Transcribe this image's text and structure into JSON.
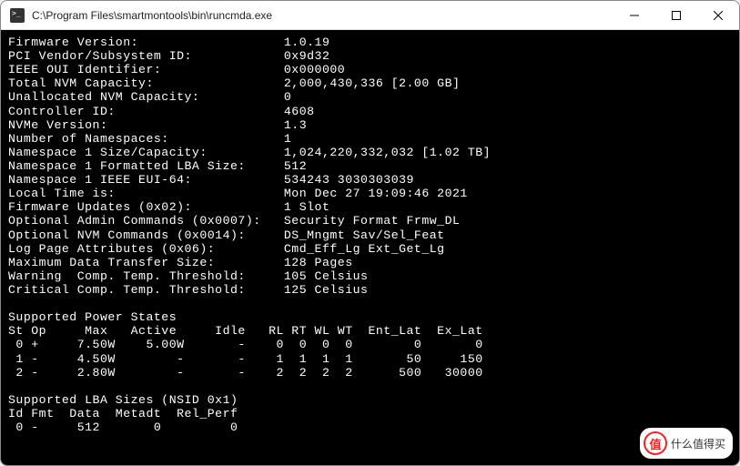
{
  "window": {
    "title": "C:\\Program Files\\smartmontools\\bin\\runcmda.exe"
  },
  "info_rows": [
    {
      "label": "Firmware Version:",
      "value": "1.0.19"
    },
    {
      "label": "PCI Vendor/Subsystem ID:",
      "value": "0x9d32"
    },
    {
      "label": "IEEE OUI Identifier:",
      "value": "0x000000"
    },
    {
      "label": "Total NVM Capacity:",
      "value": "2,000,430,336 [2.00 GB]"
    },
    {
      "label": "Unallocated NVM Capacity:",
      "value": "0"
    },
    {
      "label": "Controller ID:",
      "value": "4608"
    },
    {
      "label": "NVMe Version:",
      "value": "1.3"
    },
    {
      "label": "Number of Namespaces:",
      "value": "1"
    },
    {
      "label": "Namespace 1 Size/Capacity:",
      "value": "1,024,220,332,032 [1.02 TB]"
    },
    {
      "label": "Namespace 1 Formatted LBA Size:",
      "value": "512"
    },
    {
      "label": "Namespace 1 IEEE EUI-64:",
      "value": "534243 3030303039"
    },
    {
      "label": "Local Time is:",
      "value": "Mon Dec 27 19:09:46 2021"
    },
    {
      "label": "Firmware Updates (0x02):",
      "value": "1 Slot"
    },
    {
      "label": "Optional Admin Commands (0x0007):",
      "value": "Security Format Frmw_DL"
    },
    {
      "label": "Optional NVM Commands (0x0014):",
      "value": "DS_Mngmt Sav/Sel_Feat"
    },
    {
      "label": "Log Page Attributes (0x06):",
      "value": "Cmd_Eff_Lg Ext_Get_Lg"
    },
    {
      "label": "Maximum Data Transfer Size:",
      "value": "128 Pages"
    },
    {
      "label": "Warning  Comp. Temp. Threshold:",
      "value": "105 Celsius"
    },
    {
      "label": "Critical Comp. Temp. Threshold:",
      "value": "125 Celsius"
    }
  ],
  "power_states": {
    "heading": "Supported Power States",
    "columns": "St Op     Max   Active     Idle   RL RT WL WT  Ent_Lat  Ex_Lat",
    "rows": [
      " 0 +     7.50W    5.00W       -    0  0  0  0        0       0",
      " 1 -     4.50W        -       -    1  1  1  1       50     150",
      " 2 -     2.80W        -       -    2  2  2  2      500   30000"
    ]
  },
  "lba_sizes": {
    "heading": "Supported LBA Sizes (NSID 0x1)",
    "columns": "Id Fmt  Data  Metadt  Rel_Perf",
    "rows": [
      " 0 -     512       0         0"
    ]
  },
  "watermark": {
    "badge": "值",
    "text": "什么值得买"
  }
}
